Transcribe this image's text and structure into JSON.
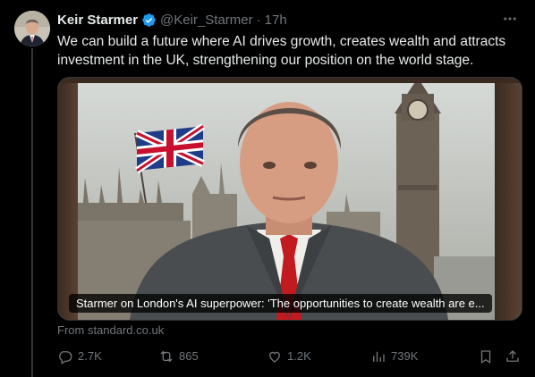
{
  "author": {
    "name": "Keir Starmer",
    "handle": "@Keir_Starmer",
    "separator": "·",
    "time": "17h",
    "verified": true
  },
  "tweet": {
    "text": "We can build a future where AI drives growth, creates wealth and attracts investment in the UK, strengthening our position on the world stage."
  },
  "card": {
    "caption": "Starmer on London's AI superpower: 'The opportunities to create wealth are e...",
    "source": "From standard.co.uk"
  },
  "actions": {
    "replies": "2.7K",
    "reposts": "865",
    "likes": "1.2K",
    "views": "739K"
  },
  "icons": {
    "verified": "verified-badge-icon",
    "more": "more-icon",
    "reply": "reply-icon",
    "repost": "repost-icon",
    "like": "heart-icon",
    "views": "views-icon",
    "bookmark": "bookmark-icon",
    "share": "share-icon"
  },
  "colors": {
    "background": "#000000",
    "text": "#e7e9ea",
    "muted": "#71767b",
    "verified": "#1d9bf0"
  }
}
